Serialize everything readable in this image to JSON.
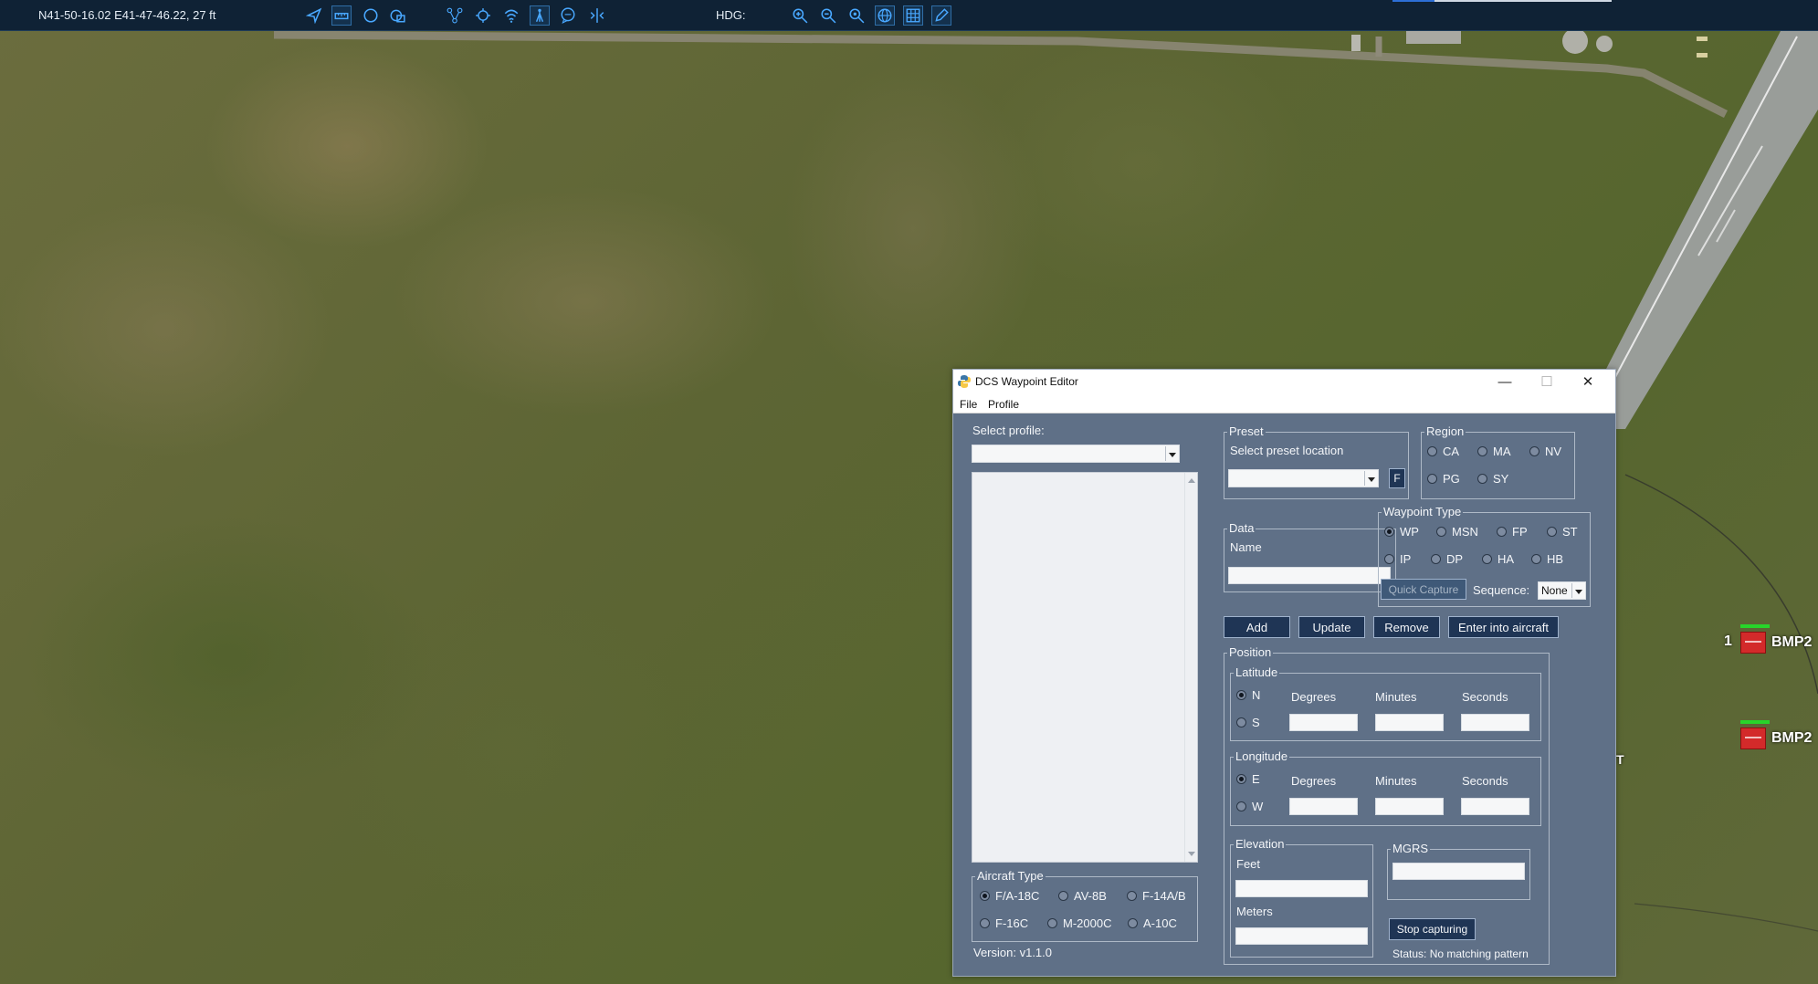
{
  "toolbar": {
    "coordinates": "N41-50-16.02 E41-47-46.22, 27 ft",
    "hdg_label": "HDG:",
    "icons": [
      "navigate-icon",
      "ruler-icon",
      "circle-icon",
      "layers-icon",
      "route-icon",
      "crosshair-icon",
      "wifi-icon",
      "tower-icon",
      "chat-icon",
      "split-icon",
      "zoom-in-icon",
      "zoom-out-icon",
      "zoom-fit-icon",
      "globe-icon",
      "grid-icon",
      "pencil-icon"
    ]
  },
  "map": {
    "units": [
      {
        "id_prefix": "1",
        "label": "BMP2"
      },
      {
        "label": "BMP2"
      }
    ],
    "edge_letter": "T"
  },
  "window": {
    "title": "DCS Waypoint Editor",
    "menu": {
      "file": "File",
      "profile": "Profile"
    },
    "controls": {
      "minimize": "—",
      "maximize": "☐",
      "close": "✕"
    },
    "select_profile_label": "Select profile:",
    "preset": {
      "title": "Preset",
      "select_label": "Select preset location",
      "f_button": "F"
    },
    "region": {
      "title": "Region",
      "options": [
        "CA",
        "MA",
        "NV",
        "PG",
        "SY"
      ]
    },
    "data": {
      "title": "Data",
      "name_label": "Name"
    },
    "waypoint_type": {
      "title": "Waypoint Type",
      "options": [
        "WP",
        "MSN",
        "FP",
        "ST",
        "IP",
        "DP",
        "HA",
        "HB"
      ],
      "selected": "WP",
      "quick_capture": "Quick Capture",
      "sequence_label": "Sequence:",
      "sequence_value": "None"
    },
    "actions": {
      "add": "Add",
      "update": "Update",
      "remove": "Remove",
      "enter": "Enter into aircraft"
    },
    "position": {
      "title": "Position",
      "latitude": {
        "title": "Latitude",
        "n": "N",
        "s": "S",
        "degrees": "Degrees",
        "minutes": "Minutes",
        "seconds": "Seconds"
      },
      "longitude": {
        "title": "Longitude",
        "e": "E",
        "w": "W",
        "degrees": "Degrees",
        "minutes": "Minutes",
        "seconds": "Seconds"
      }
    },
    "elevation": {
      "title": "Elevation",
      "feet": "Feet",
      "meters": "Meters"
    },
    "mgrs": {
      "title": "MGRS"
    },
    "stop_capturing": "Stop capturing",
    "status": "Status: No matching pattern",
    "aircraft": {
      "title": "Aircraft Type",
      "options": [
        "F/A-18C",
        "AV-8B",
        "F-14A/B",
        "F-16C",
        "M-2000C",
        "A-10C"
      ],
      "selected": "F/A-18C"
    },
    "version": "Version: v1.1.0"
  },
  "colors": {
    "toolbar_bg": "#0f2235",
    "toolbar_icon": "#49a8ff",
    "window_bg": "#5f7087",
    "button_bg": "#1f3555",
    "enemy_unit": "#d32a2a",
    "health_bar": "#27d52a"
  }
}
